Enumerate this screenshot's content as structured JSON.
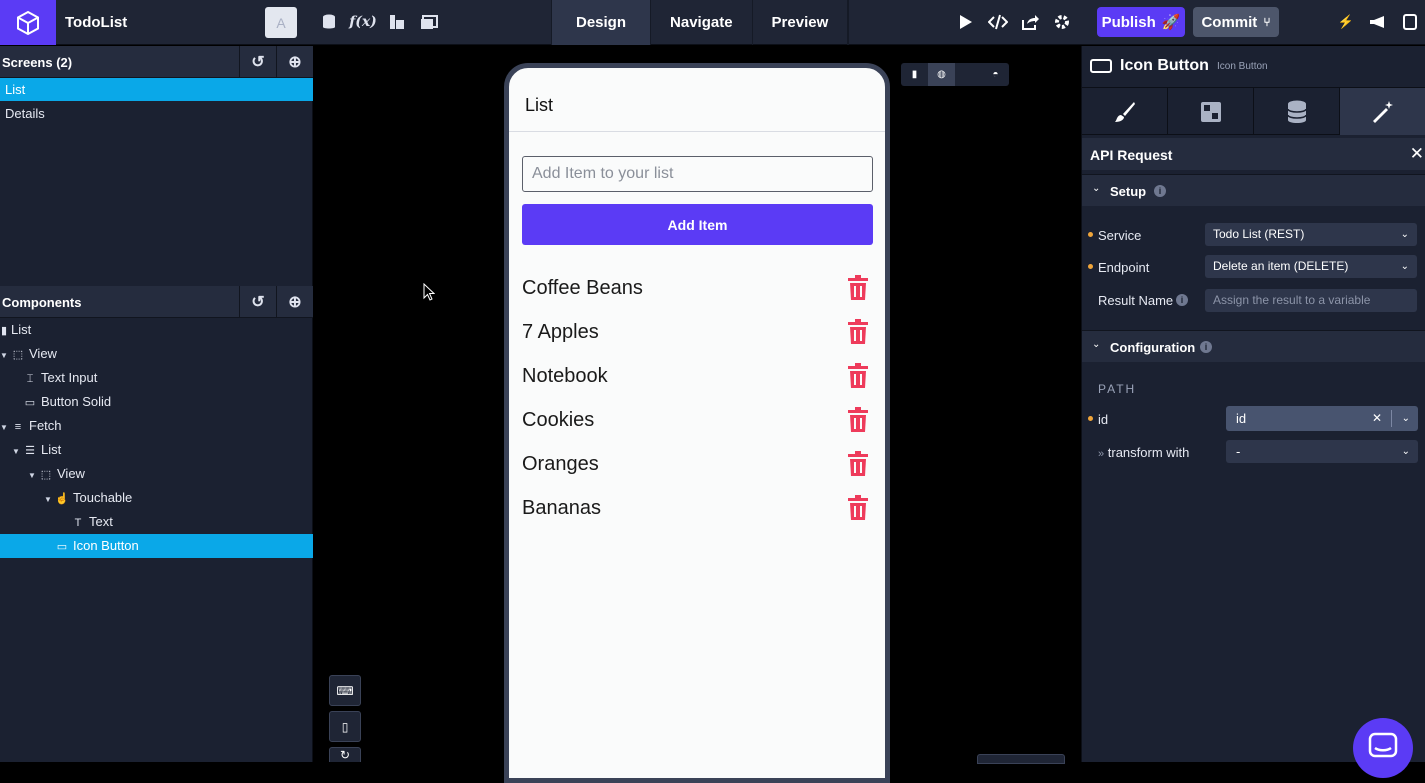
{
  "header": {
    "app_title": "TodoList",
    "avatar_letter": "A",
    "modes": [
      "Design",
      "Navigate",
      "Preview"
    ],
    "active_mode": "Design",
    "publish_label": "Publish",
    "commit_label": "Commit"
  },
  "screens": {
    "title": "Screens (2)",
    "items": [
      "List",
      "Details"
    ],
    "selected": "List"
  },
  "components": {
    "title": "Components",
    "tree": [
      {
        "label": "List",
        "icon": "screen-icon",
        "depth": 0,
        "caret": false
      },
      {
        "label": "View",
        "icon": "view-icon",
        "depth": 0,
        "caret": true
      },
      {
        "label": "Text Input",
        "icon": "text-input-icon",
        "depth": 1,
        "caret": false
      },
      {
        "label": "Button Solid",
        "icon": "button-icon",
        "depth": 1,
        "caret": false
      },
      {
        "label": "Fetch",
        "icon": "database-icon",
        "depth": 0,
        "caret": true
      },
      {
        "label": "List",
        "icon": "list-icon",
        "depth": 1,
        "caret": true
      },
      {
        "label": "View",
        "icon": "view-icon",
        "depth": 2,
        "caret": true
      },
      {
        "label": "Touchable",
        "icon": "touch-icon",
        "depth": 3,
        "caret": true
      },
      {
        "label": "Text",
        "icon": "text-icon",
        "depth": 4,
        "caret": false
      },
      {
        "label": "Icon Button",
        "icon": "button-icon",
        "depth": 3,
        "caret": false
      }
    ],
    "selected_index": 9
  },
  "phone": {
    "screen_title": "List",
    "input_placeholder": "Add Item to your list",
    "add_button": "Add Item",
    "todos": [
      "Coffee Beans",
      "7 Apples",
      "Notebook",
      "Cookies",
      "Oranges",
      "Bananas"
    ],
    "trash_color": "#ee3b5b"
  },
  "inspector": {
    "component_title": "Icon Button",
    "component_subtitle": "Icon Button",
    "panel_title": "API Request",
    "setup_title": "Setup",
    "service_label": "Service",
    "service_value": "Todo List (REST)",
    "endpoint_label": "Endpoint",
    "endpoint_value": "Delete an item (DELETE)",
    "result_label": "Result Name",
    "result_placeholder": "Assign the result to a variable",
    "config_title": "Configuration",
    "path_label": "PATH",
    "id_label": "id",
    "id_value": "id",
    "transform_label": "transform with",
    "transform_value": "-"
  },
  "colors": {
    "accent": "#5b3bf5",
    "selection": "#0aa8e8",
    "panel_bg": "#1b2131"
  }
}
